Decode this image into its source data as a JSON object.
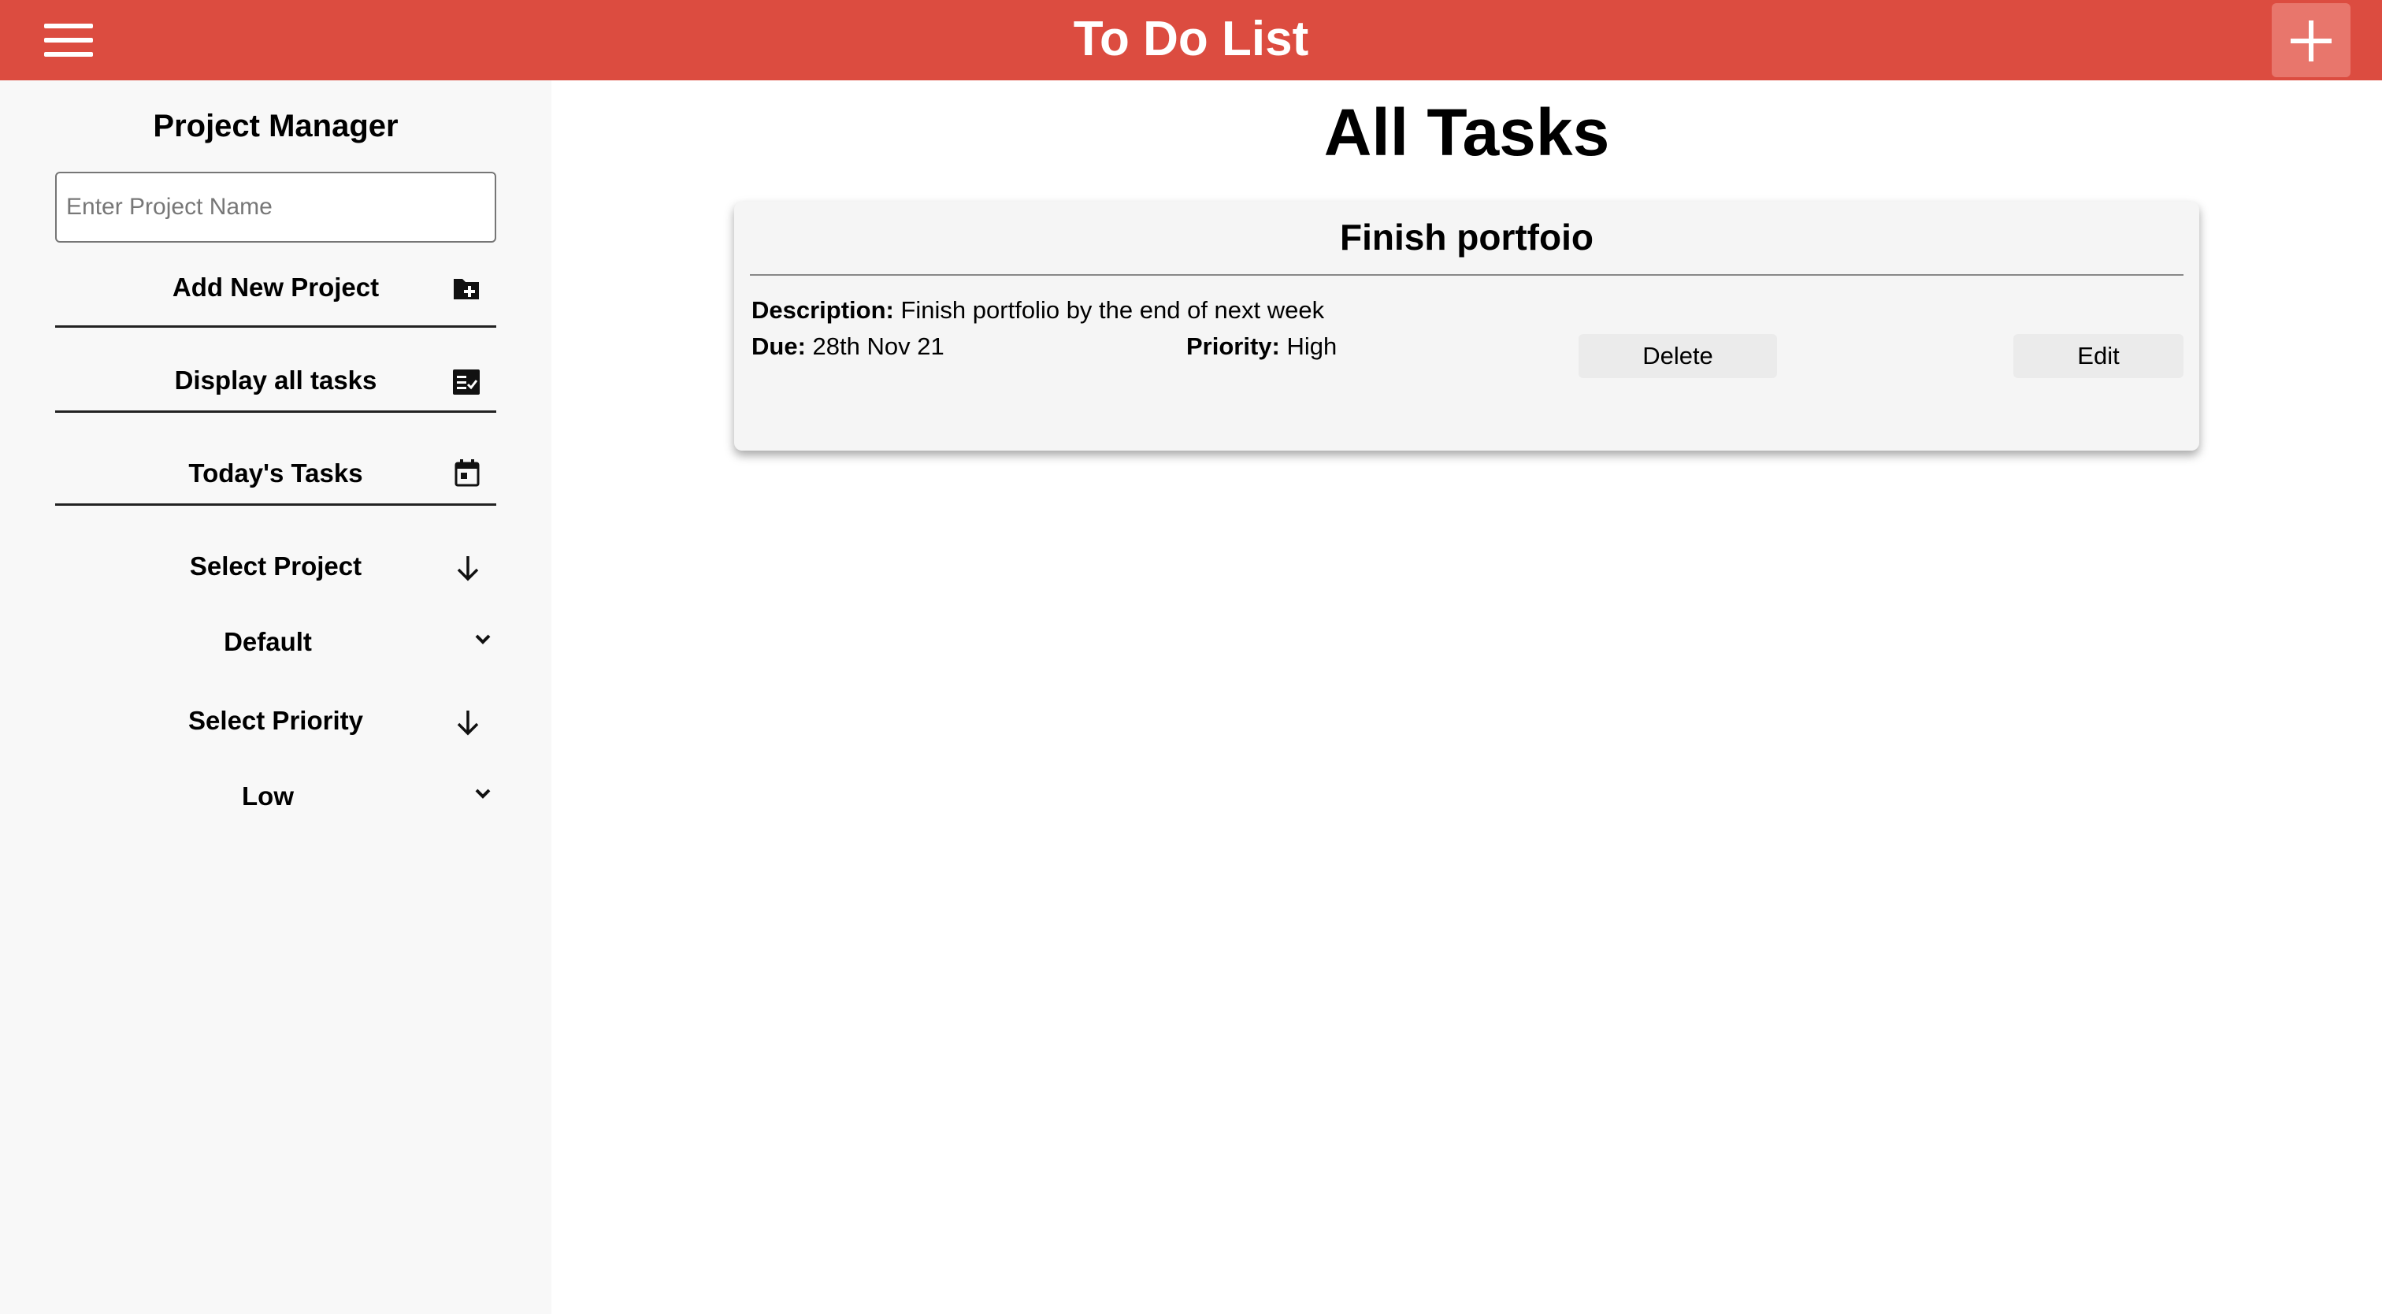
{
  "header": {
    "title": "To Do List"
  },
  "sidebar": {
    "title": "Project Manager",
    "project_input": {
      "placeholder": "Enter Project Name",
      "value": ""
    },
    "add_project_label": "Add New Project",
    "display_all_label": "Display all tasks",
    "todays_tasks_label": "Today's Tasks",
    "select_project_label": "Select Project",
    "project_selected": "Default",
    "select_priority_label": "Select Priority",
    "priority_selected": "Low"
  },
  "main": {
    "title": "All Tasks",
    "tasks": [
      {
        "title": "Finish portfoio",
        "description_label": "Description:",
        "description": "Finish portfolio by the end of next week",
        "due_label": "Due:",
        "due": "28th Nov 21",
        "priority_label": "Priority:",
        "priority": "High",
        "delete_label": "Delete",
        "edit_label": "Edit"
      }
    ]
  },
  "colors": {
    "header_bg": "#dc4c40",
    "add_button_bg": "#e8766c",
    "sidebar_bg": "#f8f8f8",
    "card_bg": "#f5f5f5"
  },
  "icons": [
    "hamburger-menu-icon",
    "plus-icon",
    "folder-add-icon",
    "task-list-icon",
    "calendar-icon",
    "arrow-down-icon",
    "chevron-down-icon"
  ]
}
